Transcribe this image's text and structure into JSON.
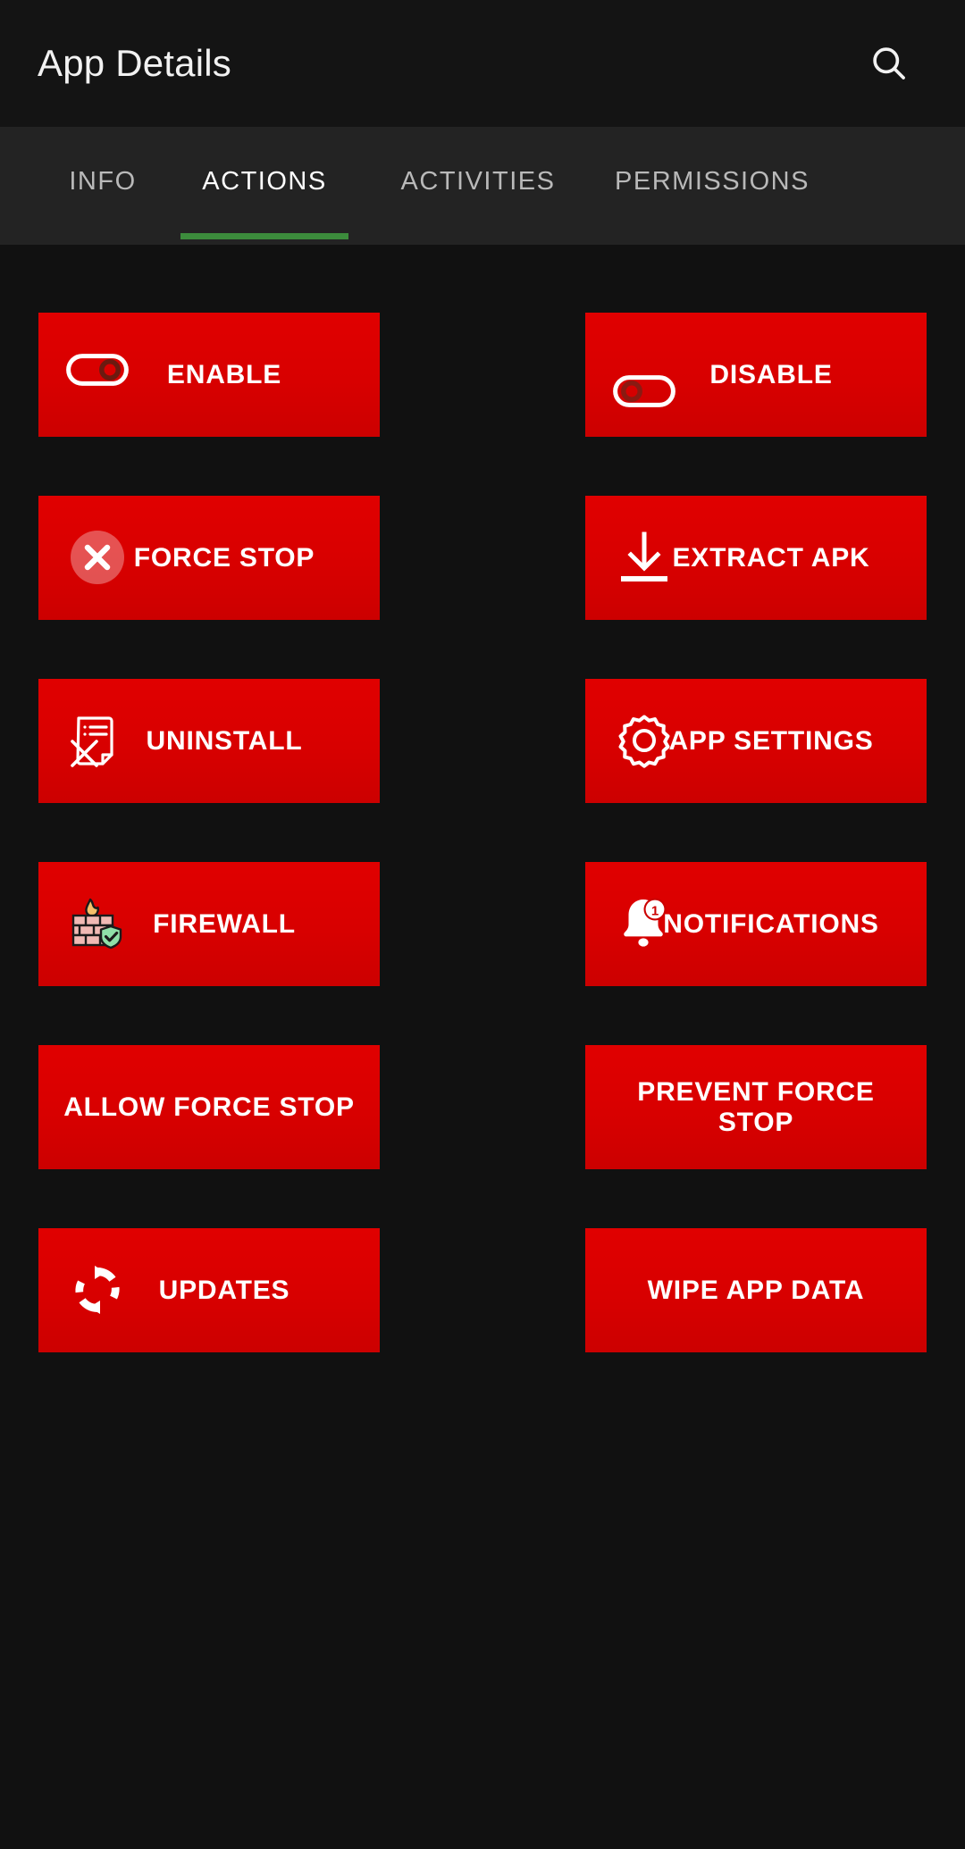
{
  "appbar": {
    "title": "App Details",
    "search_icon": "search-icon"
  },
  "tabs": [
    {
      "label": "INFO",
      "active": false
    },
    {
      "label": "ACTIONS",
      "active": true
    },
    {
      "label": "ACTIVITIES",
      "active": false
    },
    {
      "label": "PERMISSIONS",
      "active": false
    }
  ],
  "colors": {
    "button_red": "#d80000",
    "tab_indicator_green": "#3c8c3c",
    "appbar_bg": "#141414",
    "tabbar_bg": "#232323",
    "content_bg": "#111111",
    "text_primary": "#ffffff",
    "text_inactive_tab": "#b9b9b9"
  },
  "actions": [
    [
      {
        "label": "ENABLE",
        "icon": "toggle-on-icon"
      },
      {
        "label": "DISABLE",
        "icon": "toggle-off-icon"
      }
    ],
    [
      {
        "label": "FORCE STOP",
        "icon": "circle-x-icon"
      },
      {
        "label": "EXTRACT APK",
        "icon": "download-icon"
      }
    ],
    [
      {
        "label": "UNINSTALL",
        "icon": "document-x-icon"
      },
      {
        "label": "APP SETTINGS",
        "icon": "gear-icon"
      }
    ],
    [
      {
        "label": "FIREWALL",
        "icon": "firewall-brick-shield-icon"
      },
      {
        "label": "NOTIFICATIONS",
        "icon": "bell-badge-icon",
        "badge": "1"
      }
    ],
    [
      {
        "label": "ALLOW FORCE STOP",
        "icon": null
      },
      {
        "label": "PREVENT FORCE STOP",
        "icon": null
      }
    ],
    [
      {
        "label": "UPDATES",
        "icon": "sync-refresh-icon"
      },
      {
        "label": "WIPE APP DATA",
        "icon": null
      }
    ]
  ]
}
